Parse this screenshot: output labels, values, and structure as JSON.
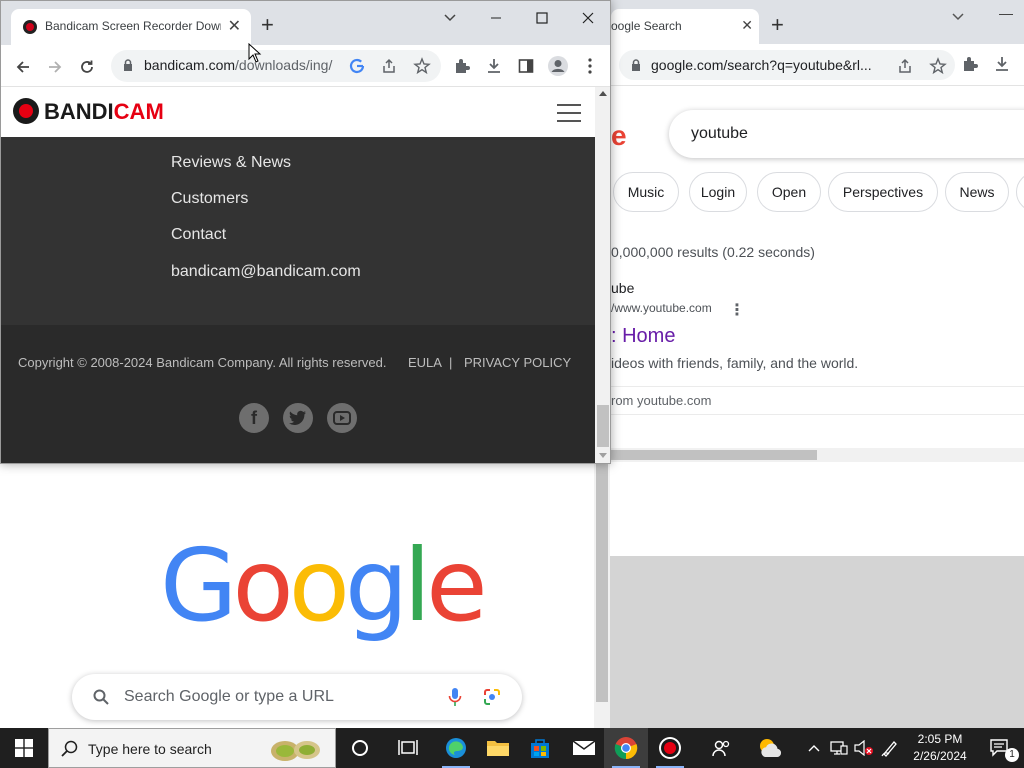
{
  "front_window": {
    "tab_title": "Bandicam Screen Recorder Down",
    "url_host": "bandicam.com",
    "url_path": "/downloads/ing/",
    "site": {
      "logo_part1": "BANDI",
      "logo_part2": "CAM",
      "links": [
        "Reviews & News",
        "Customers",
        "Contact",
        "bandicam@bandicam.com"
      ],
      "copyright": "Copyright © 2008-2024 Bandicam Company. All rights reserved.",
      "eula": "EULA",
      "separator": "|",
      "privacy": "PRIVACY POLICY"
    }
  },
  "back_window": {
    "tab_title": "oogle Search",
    "url": "google.com/search?q=youtube&rl...",
    "search_letter": "e",
    "query": "youtube",
    "chips": [
      "Music",
      "Login",
      "Open",
      "Perspectives",
      "News"
    ],
    "results_count": "0,000,000 results (0.22 seconds)",
    "result": {
      "site": "ube",
      "url": "/www.youtube.com",
      "title": ": Home",
      "snippet": "ideos with friends, family, and the world.",
      "from": "rom youtube.com"
    }
  },
  "new_tab_page": {
    "logo_letters": [
      "G",
      "o",
      "o",
      "g",
      "l",
      "e"
    ],
    "logo_colors": [
      "#4285f4",
      "#ea4335",
      "#fbbc05",
      "#4285f4",
      "#34a853",
      "#ea4335"
    ],
    "search_placeholder": "Search Google or type a URL"
  },
  "taskbar": {
    "search_placeholder": "Type here to search",
    "time": "2:05 PM",
    "date": "2/26/2024",
    "notification_count": "1"
  }
}
